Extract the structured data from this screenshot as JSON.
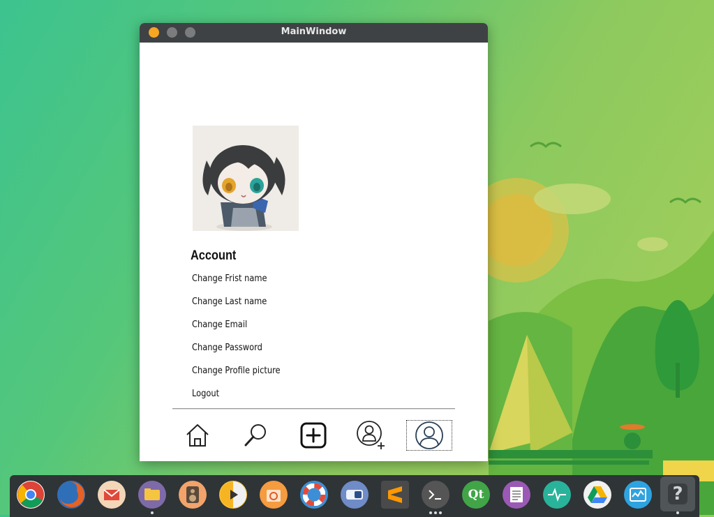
{
  "window": {
    "title": "MainWindow"
  },
  "account": {
    "section_title": "Account",
    "items": [
      {
        "label": "Change Frist name"
      },
      {
        "label": "Change Last name"
      },
      {
        "label": "Change Email"
      },
      {
        "label": "Change Password"
      },
      {
        "label": "Change Profile picture"
      },
      {
        "label": "Logout"
      }
    ]
  },
  "navbar": {
    "items": [
      {
        "icon": "home-icon"
      },
      {
        "icon": "search-icon"
      },
      {
        "icon": "add-post-icon"
      },
      {
        "icon": "add-user-icon"
      },
      {
        "icon": "profile-icon",
        "selected": true
      }
    ]
  },
  "dock": {
    "apps": [
      {
        "icon": "chrome-icon"
      },
      {
        "icon": "firefox-icon"
      },
      {
        "icon": "mail-icon"
      },
      {
        "icon": "files-icon"
      },
      {
        "icon": "speaker-icon"
      },
      {
        "icon": "media-player-icon"
      },
      {
        "icon": "ubuntu-software-icon"
      },
      {
        "icon": "help-lifebuoy-icon"
      },
      {
        "icon": "toggle-app-icon"
      },
      {
        "icon": "sublime-text-icon"
      },
      {
        "icon": "terminal-icon"
      },
      {
        "icon": "qt-creator-icon",
        "label": "Qt"
      },
      {
        "icon": "text-editor-icon"
      },
      {
        "icon": "system-monitor-pulse-icon"
      },
      {
        "icon": "google-drive-icon"
      },
      {
        "icon": "system-monitor-icon"
      },
      {
        "icon": "unknown-app-icon",
        "label": "?"
      }
    ]
  },
  "colors": {
    "close_button": "#f5a623",
    "titlebar": "#3f4244",
    "dock": "#2f3436"
  }
}
